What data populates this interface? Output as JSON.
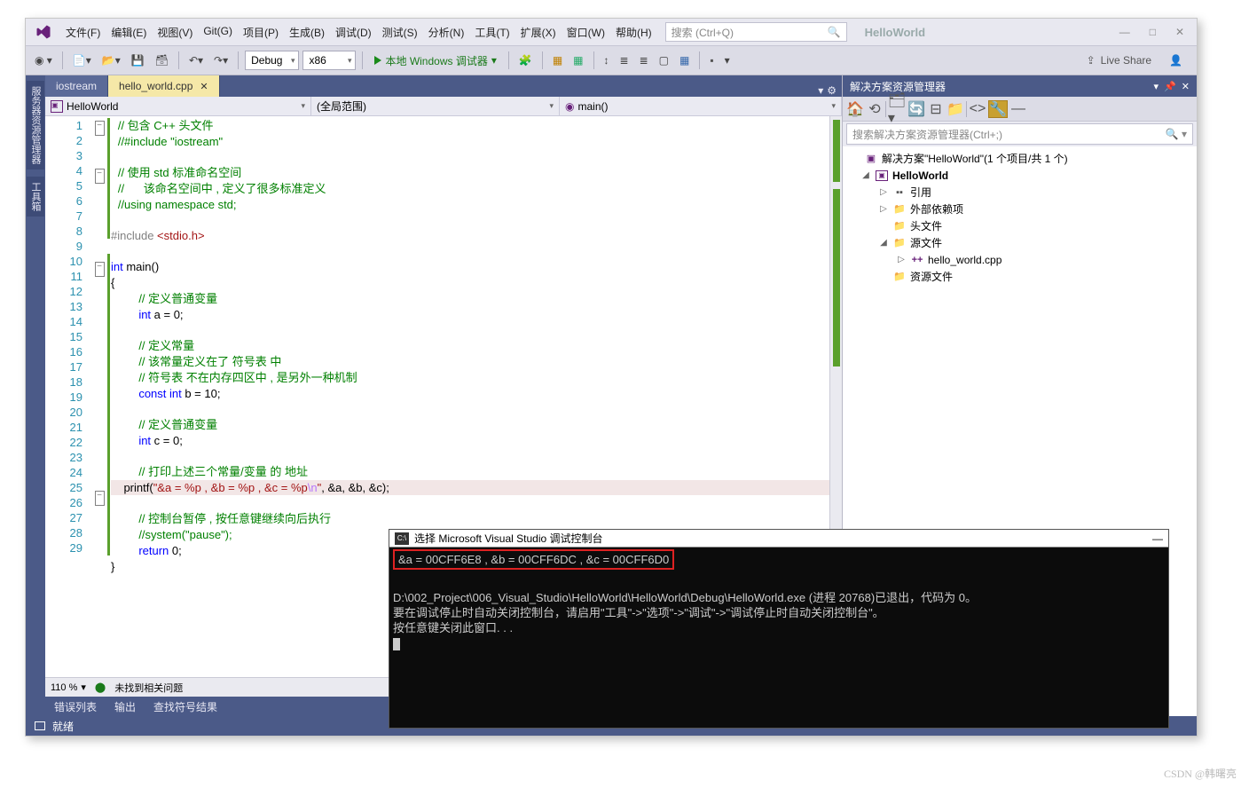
{
  "window": {
    "title": "HelloWorld",
    "search_placeholder": "搜索 (Ctrl+Q)"
  },
  "menus": {
    "file": "文件(F)",
    "edit": "编辑(E)",
    "view": "视图(V)",
    "git": "Git(G)",
    "project": "项目(P)",
    "build": "生成(B)",
    "debug": "调试(D)",
    "test": "测试(S)",
    "analyze": "分析(N)",
    "tools": "工具(T)",
    "ext": "扩展(X)",
    "window": "窗口(W)",
    "help": "帮助(H)"
  },
  "win_btns": {
    "min": "—",
    "max": "□",
    "close": "✕"
  },
  "toolbar": {
    "config": "Debug",
    "platform": "x86",
    "run": "本地 Windows 调试器",
    "live_share": "Live Share"
  },
  "tabs": {
    "t1": "iostream",
    "t2": "hello_world.cpp",
    "close": "✕"
  },
  "nav": {
    "scope": "HelloWorld",
    "global": "(全局范围)",
    "func": "main()"
  },
  "left_rail": {
    "a": "服务器资源管理器",
    "b": "工具箱"
  },
  "code_lines": [
    "1",
    "2",
    "3",
    "4",
    "5",
    "6",
    "7",
    "8",
    "9",
    "10",
    "11",
    "12",
    "13",
    "14",
    "15",
    "16",
    "17",
    "18",
    "19",
    "20",
    "21",
    "22",
    "23",
    "24",
    "25",
    "26",
    "27",
    "28",
    "29"
  ],
  "code": {
    "c1": "// 包含 C++ 头文件",
    "c2": "//#include \"iostream\"",
    "c4a": "// 使用 std 标准命名空间",
    "c5": "//      该命名空间中 , 定义了很多标准定义",
    "c6": "//using namespace std;",
    "inc": "#include ",
    "inc_h": "<stdio.h>",
    "main_kw": "int ",
    "main_id": "main()",
    "bro": "{",
    "c12": "// 定义普通变量",
    "l13_t": "int ",
    "l13_r": "a = 0;",
    "c15": "// 定义常量",
    "c16": "// 该常量定义在了 符号表 中",
    "c17": "// 符号表 不在内存四区中 , 是另外一种机制",
    "l18_t": "const int ",
    "l18_r": "b = 10;",
    "c20": "// 定义普通变量",
    "l21_t": "int ",
    "l21_r": "c = 0;",
    "c23": "// 打印上述三个常量/变量 的 地址",
    "l24_a": "printf(",
    "l24_s": "\"&a = %p , &b = %p , &c = %p",
    "l24_e": "\\n",
    "l24_s2": "\"",
    "l24_b": ", &a, &b, &c);",
    "c26": "// 控制台暂停 , 按任意键继续向后执行",
    "c27": "//system(\"pause\");",
    "l28_t": "return ",
    "l28_r": "0;",
    "brc": "}"
  },
  "bottom": {
    "zoom": "110 %",
    "issues": "未找到相关问题",
    "tab_err": "错误列表",
    "tab_out": "输出",
    "tab_sym": "查找符号结果"
  },
  "status": {
    "ready": "就绪"
  },
  "sol": {
    "title": "解决方案资源管理器",
    "search": "搜索解决方案资源管理器(Ctrl+;)",
    "root": "解决方案\"HelloWorld\"(1 个项目/共 1 个)",
    "proj": "HelloWorld",
    "ref": "引用",
    "ext": "外部依赖项",
    "hdr": "头文件",
    "src": "源文件",
    "file": "hello_world.cpp",
    "res": "资源文件"
  },
  "console": {
    "title": "选择 Microsoft Visual Studio 调试控制台",
    "line1": "&a = 00CFF6E8 , &b = 00CFF6DC , &c = 00CFF6D0",
    "line2": "D:\\002_Project\\006_Visual_Studio\\HelloWorld\\HelloWorld\\Debug\\HelloWorld.exe (进程 20768)已退出，代码为 0。",
    "line3": "要在调试停止时自动关闭控制台，请启用\"工具\"->\"选项\"->\"调试\"->\"调试停止时自动关闭控制台\"。",
    "line4": "按任意键关闭此窗口. . ."
  },
  "watermark": "CSDN @韩曙亮"
}
